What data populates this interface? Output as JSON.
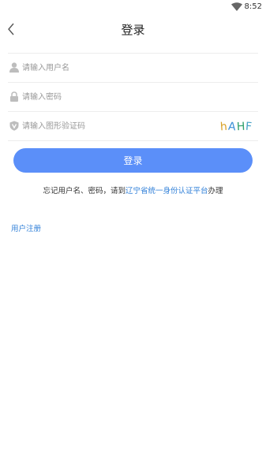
{
  "status_bar": {
    "time": "8:52"
  },
  "header": {
    "title": "登录"
  },
  "form": {
    "username_placeholder": "请输入用户名",
    "password_placeholder": "请输入密码",
    "captcha_placeholder": "请输入图形验证码",
    "captcha_text": "hAHF"
  },
  "login_button": {
    "label": "登录"
  },
  "hint": {
    "prefix": "忘记用户名、密码，请到",
    "link": "辽宁省统一身份认证平台",
    "suffix": "办理"
  },
  "register_link": {
    "label": "用户注册"
  },
  "colors": {
    "primary": "#5b8ff9",
    "link": "#2f7fd8"
  },
  "icons": [
    "wifi-icon",
    "back-arrow-icon",
    "user-icon",
    "lock-icon",
    "shield-v-icon"
  ]
}
